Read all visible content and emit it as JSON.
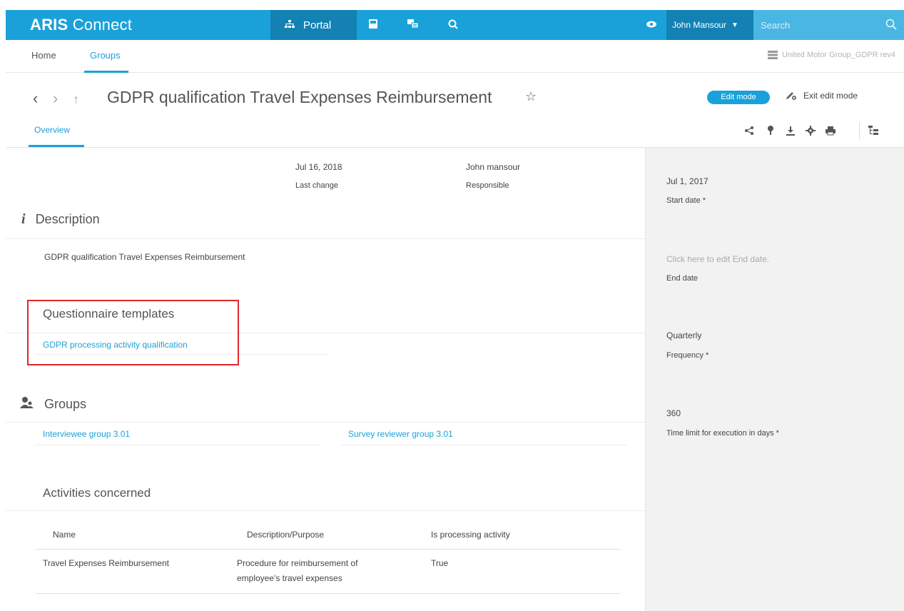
{
  "topbar": {
    "brand_bold": "ARIS",
    "brand_rest": "Connect",
    "portal_label": "Portal",
    "user_name": "John Mansour",
    "search_placeholder": "Search",
    "colors": {
      "bar": "#1ba1d9",
      "bar_dark": "#1381b3",
      "search_bg": "#4ab6e3"
    },
    "icons": [
      "portal-icon",
      "model-icon",
      "collaboration-icon",
      "search-icon",
      "eye-icon",
      "search-icon"
    ]
  },
  "subnav": {
    "tabs": [
      {
        "label": "Home"
      },
      {
        "label": "Groups",
        "active": true
      }
    ],
    "database": "United Motor Group_GDPR rev4"
  },
  "header": {
    "title": "GDPR qualification Travel Expenses Reimbursement",
    "edit_badge": "Edit mode",
    "exit_edit": "Exit edit mode",
    "tab": "Overview",
    "tools": [
      "share-icon",
      "pin-icon",
      "download-icon",
      "settings-icon",
      "print-icon",
      "structure-icon"
    ]
  },
  "meta": {
    "last_change_value": "Jul 16, 2018",
    "last_change_label": "Last change",
    "responsible_value": "John mansour",
    "responsible_label": "Responsible"
  },
  "description": {
    "title": "Description",
    "text": "GDPR qualification Travel Expenses Reimbursement"
  },
  "questionnaire": {
    "title": "Questionnaire templates",
    "link": "GDPR processing activity qualification"
  },
  "groups": {
    "title": "Groups",
    "items": [
      "Interviewee group 3.01",
      "Survey reviewer group 3.01"
    ]
  },
  "activities": {
    "title": "Activities concerned",
    "columns": [
      "Name",
      "Description/Purpose",
      "Is processing activity"
    ],
    "rows": [
      {
        "name": "Travel Expenses Reimbursement",
        "desc_line1": "Procedure for reimbursement of",
        "desc_line2": "employee's travel expenses",
        "processing": "True"
      }
    ]
  },
  "right_panel": {
    "start_date_value": "Jul 1, 2017",
    "start_date_label": "Start date *",
    "end_date_value": "Click here to edit End date.",
    "end_date_label": "End date",
    "frequency_value": "Quarterly",
    "frequency_label": "Frequency *",
    "time_limit_value": "360",
    "time_limit_label": "Time limit for execution in days *"
  }
}
